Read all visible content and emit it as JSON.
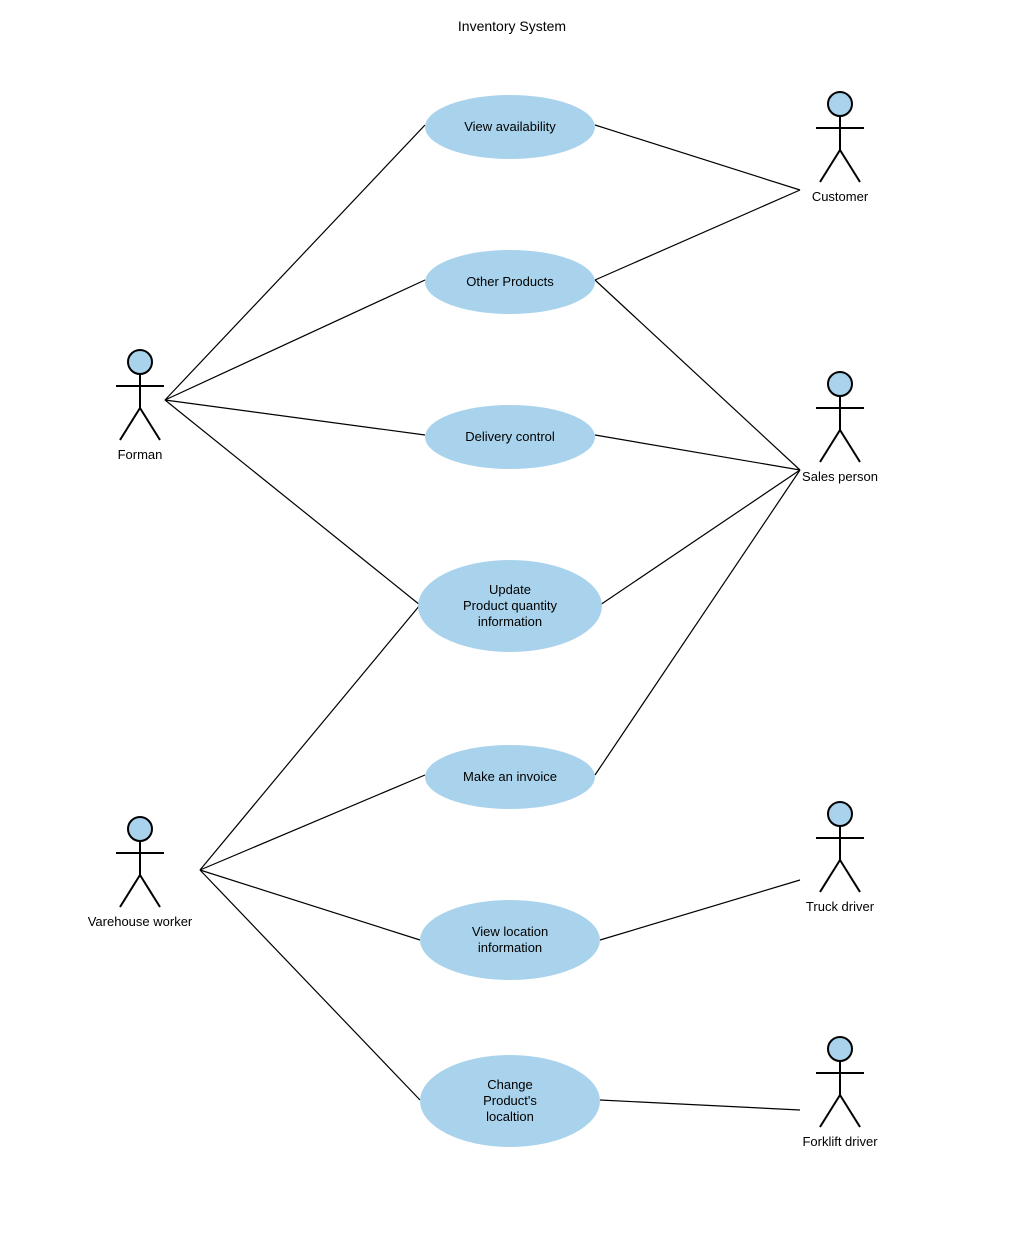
{
  "title": "Inventory System",
  "actors": {
    "forman": {
      "label": "Forman"
    },
    "customer": {
      "label": "Customer"
    },
    "sales": {
      "label": "Sales person"
    },
    "warehouse": {
      "label": "Varehouse worker"
    },
    "truck": {
      "label": "Truck driver"
    },
    "forklift": {
      "label": "Forklift driver"
    }
  },
  "usecases": {
    "view_availability": "View availability",
    "other_products": "Other Products",
    "delivery_control": "Delivery control",
    "update_qty": "Update\nProduct quantity\ninformation",
    "make_invoice": "Make an invoice",
    "view_location": "View location\ninformation",
    "change_location": "Change\nProduct's\nlocaltion"
  },
  "chart_data": {
    "type": "uml-use-case",
    "system": "Inventory System",
    "actors": [
      "Forman",
      "Customer",
      "Sales person",
      "Varehouse worker",
      "Truck driver",
      "Forklift driver"
    ],
    "use_cases": [
      "View availability",
      "Other Products",
      "Delivery control",
      "Update Product quantity information",
      "Make an invoice",
      "View location information",
      "Change Product's localtion"
    ],
    "associations": [
      [
        "Forman",
        "View availability"
      ],
      [
        "Forman",
        "Other Products"
      ],
      [
        "Forman",
        "Delivery control"
      ],
      [
        "Forman",
        "Update Product quantity information"
      ],
      [
        "Customer",
        "View availability"
      ],
      [
        "Customer",
        "Other Products"
      ],
      [
        "Sales person",
        "Other Products"
      ],
      [
        "Sales person",
        "Delivery control"
      ],
      [
        "Sales person",
        "Update Product quantity information"
      ],
      [
        "Sales person",
        "Make an invoice"
      ],
      [
        "Varehouse worker",
        "Update Product quantity information"
      ],
      [
        "Varehouse worker",
        "Make an invoice"
      ],
      [
        "Varehouse worker",
        "View location information"
      ],
      [
        "Varehouse worker",
        "Change Product's localtion"
      ],
      [
        "Truck driver",
        "View location information"
      ],
      [
        "Forklift driver",
        "Change Product's localtion"
      ]
    ]
  }
}
